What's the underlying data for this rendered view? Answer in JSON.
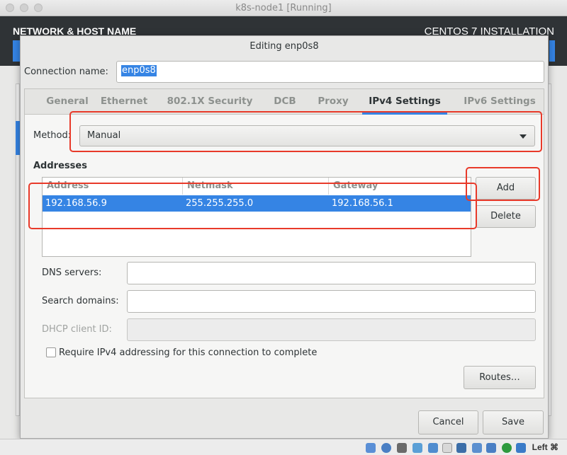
{
  "window": {
    "title": "k8s-node1 [Running]"
  },
  "installer": {
    "title": "NETWORK & HOST NAME",
    "right_title": "CENTOS 7 INSTALLATION"
  },
  "dialog": {
    "title": "Editing enp0s8",
    "connection_name_label": "Connection name:",
    "connection_name_value": "enp0s8",
    "tabs": [
      "General",
      "Ethernet",
      "802.1X Security",
      "DCB",
      "Proxy",
      "IPv4 Settings",
      "IPv6 Settings"
    ],
    "active_tab": "IPv4 Settings",
    "method_label": "Method:",
    "method_value": "Manual",
    "addresses_title": "Addresses",
    "table": {
      "columns": [
        "Address",
        "Netmask",
        "Gateway"
      ],
      "rows": [
        {
          "address": "192.168.56.9",
          "netmask": "255.255.255.0",
          "gateway": "192.168.56.1"
        }
      ]
    },
    "add_label": "Add",
    "delete_label": "Delete",
    "dns_label": "DNS servers:",
    "search_label": "Search domains:",
    "dhcp_label": "DHCP client ID:",
    "require_label": "Require IPv4 addressing for this connection to complete",
    "routes_label": "Routes…",
    "cancel_label": "Cancel",
    "save_label": "Save"
  },
  "statusbar": {
    "host_key": "Left ⌘"
  },
  "colors": {
    "accent": "#3584e4",
    "annotation": "#e83a2a",
    "header": "#2f3336"
  }
}
